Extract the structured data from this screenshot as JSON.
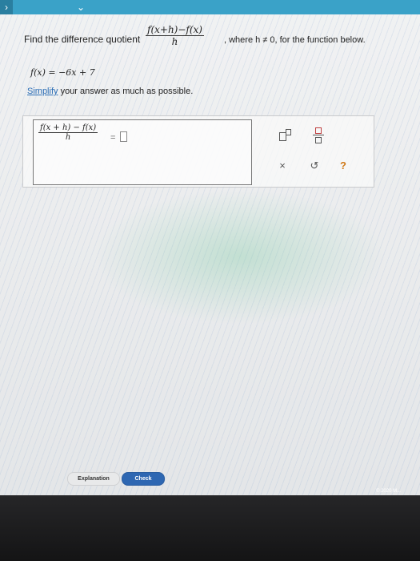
{
  "topbar": {
    "left_chevron": "›",
    "down_chevron": "⌄",
    "accent_color": "#3aa2c8"
  },
  "question": {
    "prefix": "Find the difference quotient",
    "quotient_numerator": "f(x+h)−f(x)",
    "quotient_denominator": "h",
    "suffix": ", where h ≠ 0, for the function below."
  },
  "function_definition": "f(x) = −6x + 7",
  "instruction": {
    "link_text": "Simplify",
    "rest": " your answer as much as possible."
  },
  "answer": {
    "numerator": "f(x + h) − f(x)",
    "denominator": "h",
    "equals": "=",
    "value": ""
  },
  "toolbar": {
    "exponent_icon": "exponent-icon",
    "fraction_icon": "fraction-icon",
    "clear_symbol": "×",
    "undo_symbol": "↺",
    "help_symbol": "?"
  },
  "buttons": {
    "explanation": "Explanation",
    "check": "Check"
  },
  "footer": {
    "copyright": "© 2020 M..."
  }
}
